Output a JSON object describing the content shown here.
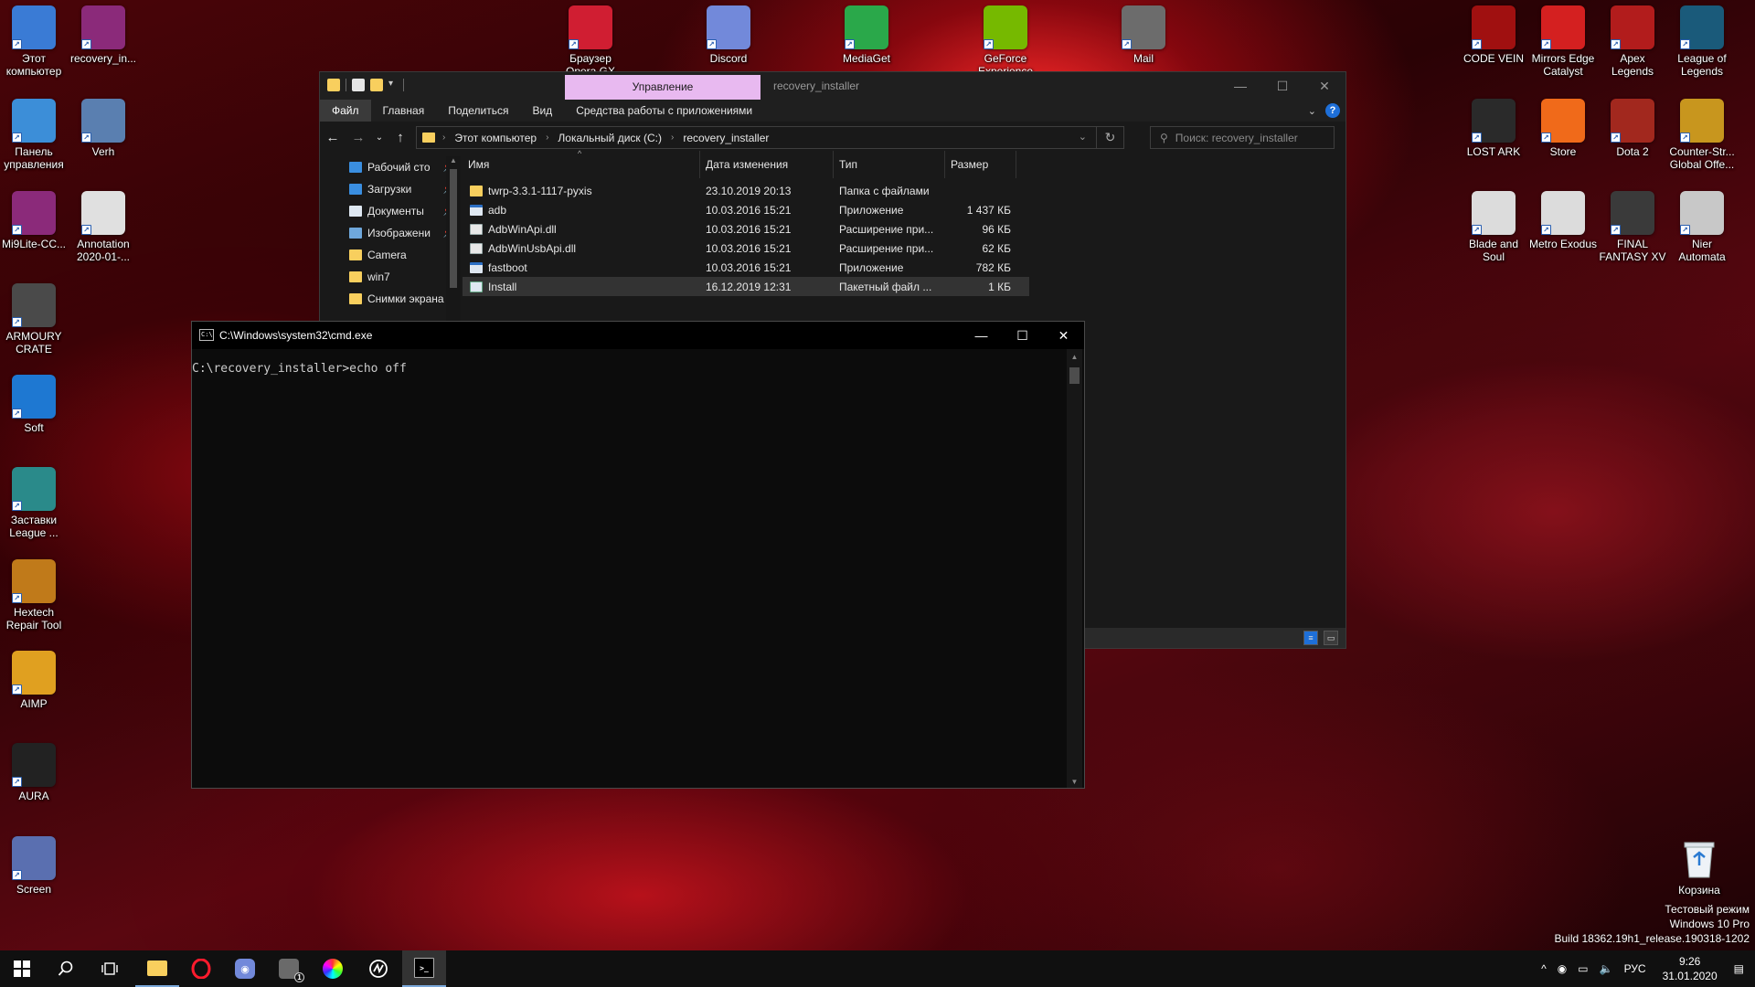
{
  "desktop": {
    "icons_left": [
      {
        "label": "Этот компьютер",
        "icon": "this-pc-icon",
        "color": "#3a7bd5"
      },
      {
        "label": "recovery_in...",
        "icon": "winrar-archive-icon",
        "color": "#8b2a7a"
      },
      {
        "label": "Панель управления",
        "icon": "control-panel-icon",
        "color": "#3c8ed8"
      },
      {
        "label": "Verh",
        "icon": "image-file-icon",
        "color": "#5a7fb0"
      },
      {
        "label": "Mi9Lite-CC...",
        "icon": "winrar-archive-icon",
        "color": "#8b2a7a"
      },
      {
        "label": "Annotation 2020-01-...",
        "icon": "image-file-icon",
        "color": "#e0e0e0"
      },
      {
        "label": "ARMOURY CRATE",
        "icon": "armoury-crate-icon",
        "color": "#4a4a4a"
      },
      {
        "label": "Soft",
        "icon": "settings-gear-icon",
        "color": "#1e78d2"
      },
      {
        "label": "Заставки League ...",
        "icon": "monitor-icon",
        "color": "#2a8a8a"
      },
      {
        "label": "Hextech Repair Tool",
        "icon": "hextech-icon",
        "color": "#c07a1a"
      },
      {
        "label": "AIMP",
        "icon": "aimp-icon",
        "color": "#e0a020"
      },
      {
        "label": "AURA",
        "icon": "aura-icon",
        "color": "#222222"
      },
      {
        "label": "Screen",
        "icon": "screen-icon",
        "color": "#5a6fb0"
      }
    ],
    "icons_top": [
      {
        "label": "Браузер Opera GX",
        "icon": "opera-icon",
        "color": "#d01e32"
      },
      {
        "label": "Discord",
        "icon": "discord-icon",
        "color": "#7289da"
      },
      {
        "label": "MediaGet",
        "icon": "mediaget-icon",
        "color": "#2aa84a"
      },
      {
        "label": "GeForce Experience",
        "icon": "nvidia-icon",
        "color": "#76b900"
      },
      {
        "label": "Mail",
        "icon": "mail-icon",
        "color": "#6c6c6c"
      }
    ],
    "icons_right": [
      {
        "label": "CODE VEIN",
        "icon": "code-vein-icon",
        "color": "#a01010"
      },
      {
        "label": "Mirrors Edge Catalyst",
        "icon": "mirrors-edge-icon",
        "color": "#d42020"
      },
      {
        "label": "Apex Legends",
        "icon": "apex-icon",
        "color": "#b21c1c"
      },
      {
        "label": "League of Legends",
        "icon": "league-icon",
        "color": "#1a5a7a"
      },
      {
        "label": "LOST ARK",
        "icon": "lost-ark-icon",
        "color": "#2a2a2a"
      },
      {
        "label": "Store",
        "icon": "origin-store-icon",
        "color": "#f06a1a"
      },
      {
        "label": "Dota 2",
        "icon": "dota2-icon",
        "color": "#a2281e"
      },
      {
        "label": "Counter-Str... Global Offe...",
        "icon": "csgo-icon",
        "color": "#c8961e"
      },
      {
        "label": "Blade and Soul",
        "icon": "blade-soul-icon",
        "color": "#dcdcdc"
      },
      {
        "label": "Metro Exodus",
        "icon": "metro-icon",
        "color": "#dcdcdc"
      },
      {
        "label": "FINAL FANTASY XV",
        "icon": "ffxv-icon",
        "color": "#3a3a3a"
      },
      {
        "label": "Nier Automata",
        "icon": "nier-icon",
        "color": "#c8c8c8"
      }
    ],
    "recycle_bin": {
      "label": "Корзина",
      "icon": "recycle-bin-icon"
    }
  },
  "explorer": {
    "manage_tab": "Управление",
    "title": "recovery_installer",
    "window_controls": {
      "minimize": "—",
      "maximize": "☐",
      "close": "✕"
    },
    "ribbon_tabs": [
      "Файл",
      "Главная",
      "Поделиться",
      "Вид",
      "Средства работы с приложениями"
    ],
    "breadcrumb": [
      "Этот компьютер",
      "Локальный диск (C:)",
      "recovery_installer"
    ],
    "search_placeholder": "Поиск: recovery_installer",
    "nav_items": [
      {
        "label": "Рабочий сто",
        "icon": "desktop-folder-icon",
        "color": "#3a8ee0",
        "pinned": true
      },
      {
        "label": "Загрузки",
        "icon": "downloads-icon",
        "color": "#3a8ee0",
        "pinned": true
      },
      {
        "label": "Документы",
        "icon": "documents-icon",
        "color": "#dfe8f2",
        "pinned": true
      },
      {
        "label": "Изображени",
        "icon": "pictures-icon",
        "color": "#6fa8dc",
        "pinned": true
      },
      {
        "label": "Camera",
        "icon": "folder-icon",
        "color": "#f8cf5e",
        "pinned": false
      },
      {
        "label": "win7",
        "icon": "folder-icon",
        "color": "#f8cf5e",
        "pinned": false
      },
      {
        "label": "Снимки экрана",
        "icon": "folder-icon",
        "color": "#f8cf5e",
        "pinned": false
      }
    ],
    "columns": [
      "Имя",
      "Дата изменения",
      "Тип",
      "Размер"
    ],
    "files": [
      {
        "name": "twrp-3.3.1-1117-pyxis",
        "date": "23.10.2019 20:13",
        "type": "Папка с файлами",
        "size": "",
        "kind": "folder"
      },
      {
        "name": "adb",
        "date": "10.03.2016 15:21",
        "type": "Приложение",
        "size": "1 437 КБ",
        "kind": "exe"
      },
      {
        "name": "AdbWinApi.dll",
        "date": "10.03.2016 15:21",
        "type": "Расширение при...",
        "size": "96 КБ",
        "kind": "dll"
      },
      {
        "name": "AdbWinUsbApi.dll",
        "date": "10.03.2016 15:21",
        "type": "Расширение при...",
        "size": "62 КБ",
        "kind": "dll"
      },
      {
        "name": "fastboot",
        "date": "10.03.2016 15:21",
        "type": "Приложение",
        "size": "782 КБ",
        "kind": "exe"
      },
      {
        "name": "Install",
        "date": "16.12.2019 12:31",
        "type": "Пакетный файл ...",
        "size": "1 КБ",
        "kind": "bat",
        "selected": true
      }
    ]
  },
  "cmd": {
    "title": "C:\\Windows\\system32\\cmd.exe",
    "icon_text": "C:\\",
    "lines": [
      "C:\\recovery_installer>echo off"
    ],
    "window_controls": {
      "minimize": "—",
      "maximize": "☐",
      "close": "✕"
    }
  },
  "taskbar": {
    "apps": [
      {
        "name": "start-button",
        "icon": "windows-logo-icon",
        "color": "#ffffff"
      },
      {
        "name": "search-button",
        "icon": "search-icon",
        "color": "#ffffff"
      },
      {
        "name": "task-view-button",
        "icon": "task-view-icon",
        "color": "#ffffff"
      },
      {
        "name": "explorer-taskbar",
        "icon": "file-explorer-icon",
        "color": "#f8cf5e"
      },
      {
        "name": "opera-taskbar",
        "icon": "opera-icon",
        "color": "#d01e32"
      },
      {
        "name": "discord-taskbar",
        "icon": "discord-icon",
        "color": "#7289da"
      },
      {
        "name": "armoury-taskbar",
        "icon": "armoury-crate-icon",
        "color": "#6a6a6a"
      },
      {
        "name": "aura-taskbar",
        "icon": "aura-icon",
        "color": "#333333"
      },
      {
        "name": "app-taskbar",
        "icon": "nahimic-icon",
        "color": "#ffffff"
      },
      {
        "name": "cmd-taskbar",
        "icon": "cmd-icon",
        "color": "#000000"
      }
    ],
    "armoury_badge": "1",
    "language": "РУС",
    "time": "9:26",
    "date": "31.01.2020"
  },
  "watermark": {
    "line1": "Тестовый режим",
    "line2": "Windows 10 Pro",
    "line3": "Build 18362.19h1_release.190318-1202"
  }
}
